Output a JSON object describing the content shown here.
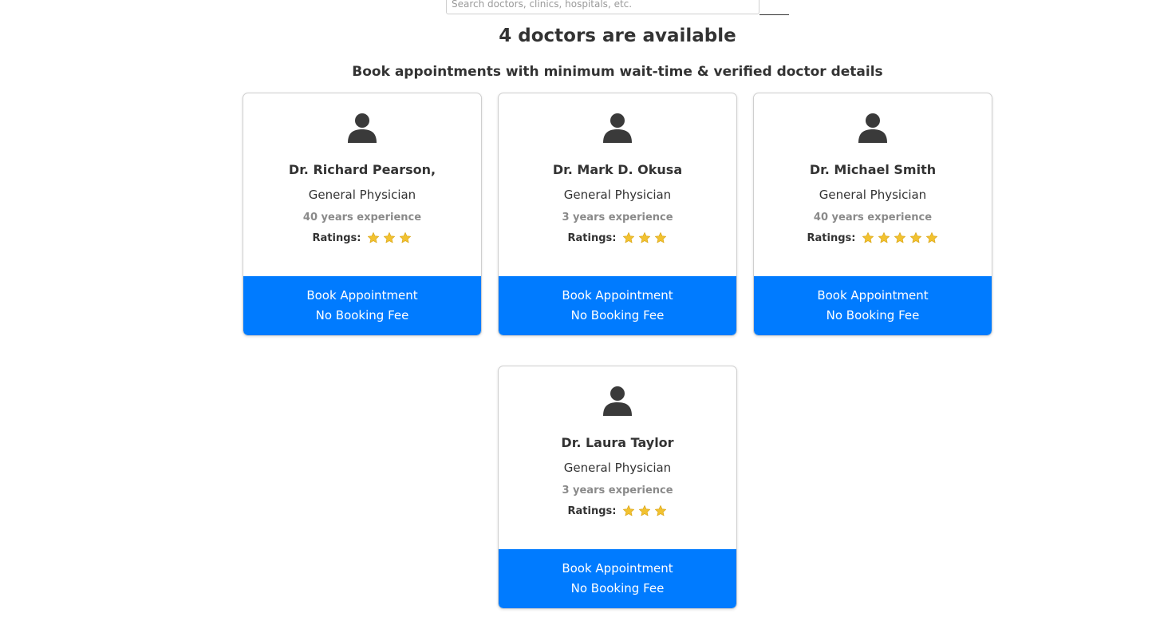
{
  "search": {
    "placeholder": "Search doctors, clinics, hospitals, etc."
  },
  "header": {
    "title": "4 doctors are available",
    "subtitle": "Book appointments with minimum wait-time & verified doctor details"
  },
  "doctors": [
    {
      "name": "Dr. Richard Pearson,",
      "speciality": "General Physician",
      "experience": "40 years experience",
      "ratings_label": "Ratings:",
      "stars": 3,
      "book_label": "Book Appointment",
      "fee_label": "No Booking Fee"
    },
    {
      "name": "Dr. Mark D. Okusa",
      "speciality": "General Physician",
      "experience": "3 years experience",
      "ratings_label": "Ratings:",
      "stars": 3,
      "book_label": "Book Appointment",
      "fee_label": "No Booking Fee"
    },
    {
      "name": "Dr. Michael Smith",
      "speciality": "General Physician",
      "experience": "40 years experience",
      "ratings_label": "Ratings:",
      "stars": 5,
      "book_label": "Book Appointment",
      "fee_label": "No Booking Fee"
    },
    {
      "name": "Dr. Laura Taylor",
      "speciality": "General Physician",
      "experience": "3 years experience",
      "ratings_label": "Ratings:",
      "stars": 3,
      "book_label": "Book Appointment",
      "fee_label": "No Booking Fee"
    }
  ],
  "colors": {
    "accent": "#007bff",
    "star": "#f2c230",
    "text": "#333333",
    "muted": "#8a8a8a"
  },
  "icons": {
    "avatar": "user-icon",
    "star": "star-icon"
  }
}
